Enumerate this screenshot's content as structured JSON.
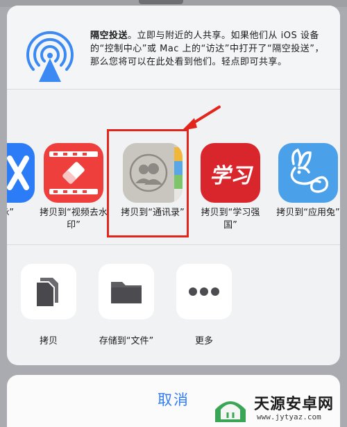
{
  "airdrop": {
    "icon": "airdrop-icon",
    "title": "隔空投送",
    "description": "。立即与附近的人共享。如果他们从 iOS 设备的“控制中心”或 Mac 上的“访达”中打开了“隔空投送”，那么您将可以在此处看到他们。轻点即可共享。"
  },
  "apps": [
    {
      "id": "partial",
      "label": "脉”",
      "icon": "app-icon-partial",
      "color": "#2b7cf6"
    },
    {
      "id": "video",
      "label": "拷贝到“视频去水印”",
      "icon": "video-watermark-icon",
      "color": "#ef3f3c"
    },
    {
      "id": "contacts",
      "label": "拷贝到“通讯录”",
      "icon": "contacts-icon",
      "color": "#c9c6c0"
    },
    {
      "id": "xuexi",
      "label": "拷贝到“学习强国”",
      "icon": "xuexi-icon",
      "color": "#d8262c",
      "glyph": "学习"
    },
    {
      "id": "rabbit",
      "label": "拷贝到“应用兔”",
      "icon": "rabbit-icon",
      "color": "#4aa1ea"
    }
  ],
  "actions": [
    {
      "id": "copy",
      "label": "拷贝",
      "icon": "copy-icon"
    },
    {
      "id": "save",
      "label": "存储到“文件”",
      "icon": "folder-icon"
    },
    {
      "id": "more",
      "label": "更多",
      "icon": "more-icon"
    }
  ],
  "cancel": {
    "label": "取消"
  },
  "watermark": {
    "title": "天源安卓网",
    "url": "www.jytyaz.com"
  },
  "colors": {
    "accent": "#2f7cf6",
    "highlight": "#e2261c"
  }
}
